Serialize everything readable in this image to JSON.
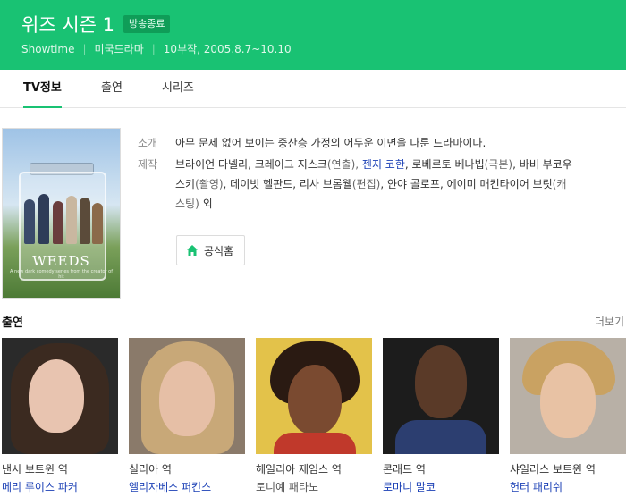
{
  "header": {
    "title": "위즈 시즌 1",
    "badge": "방송종료",
    "network": "Showtime",
    "genre": "미국드라마",
    "episodes_dates": "10부작, 2005.8.7~10.10"
  },
  "tabs": [
    {
      "label": "TV정보",
      "active": true
    },
    {
      "label": "출연",
      "active": false
    },
    {
      "label": "시리즈",
      "active": false
    }
  ],
  "poster": {
    "title": "WEEDS",
    "subtitle": "A new dark comedy series from the creator of hit"
  },
  "info": {
    "intro_label": "소개",
    "intro_text": "아무 문제 없어 보이는 중산층 가정의 어두운 이면을 다룬 드라마이다.",
    "credits_label": "제작",
    "credits": [
      {
        "text": "브라이언 다넬리, 크레이그 지스크",
        "type": "text"
      },
      {
        "text": "(연출), ",
        "type": "plain"
      },
      {
        "text": "젠지 코한",
        "type": "link"
      },
      {
        "text": ", 로베르토 베나빕",
        "type": "text"
      },
      {
        "text": "(극본)",
        "type": "plain"
      },
      {
        "text": ", 바비 부코우스키",
        "type": "text"
      },
      {
        "text": "(촬영)",
        "type": "plain"
      },
      {
        "text": ", 데이빗 헬판드, 리사 브롬웰",
        "type": "text"
      },
      {
        "text": "(편집)",
        "type": "plain"
      },
      {
        "text": ", 얀야 콜로프, 에이미 매킨타이어 브릿",
        "type": "text"
      },
      {
        "text": "(캐스팅)",
        "type": "plain"
      },
      {
        "text": " 외",
        "type": "text"
      }
    ],
    "official_button": "공식홈"
  },
  "cast_section": {
    "title": "출연",
    "more": "더보기"
  },
  "cast": [
    {
      "role": "낸시 보트윈 역",
      "actor": "메리 루이스 파커",
      "linked": true
    },
    {
      "role": "실리아 역",
      "actor": "엘리자베스 퍼킨스",
      "linked": true
    },
    {
      "role": "헤일리아 제임스 역",
      "actor": "토니예 패타노",
      "linked": false
    },
    {
      "role": "콘래드 역",
      "actor": "로마니 말코",
      "linked": true
    },
    {
      "role": "샤일러스 보트윈 역",
      "actor": "헌터 패리쉬",
      "linked": true
    }
  ],
  "colors": {
    "brand": "#19c273",
    "link": "#1a3fb5"
  }
}
